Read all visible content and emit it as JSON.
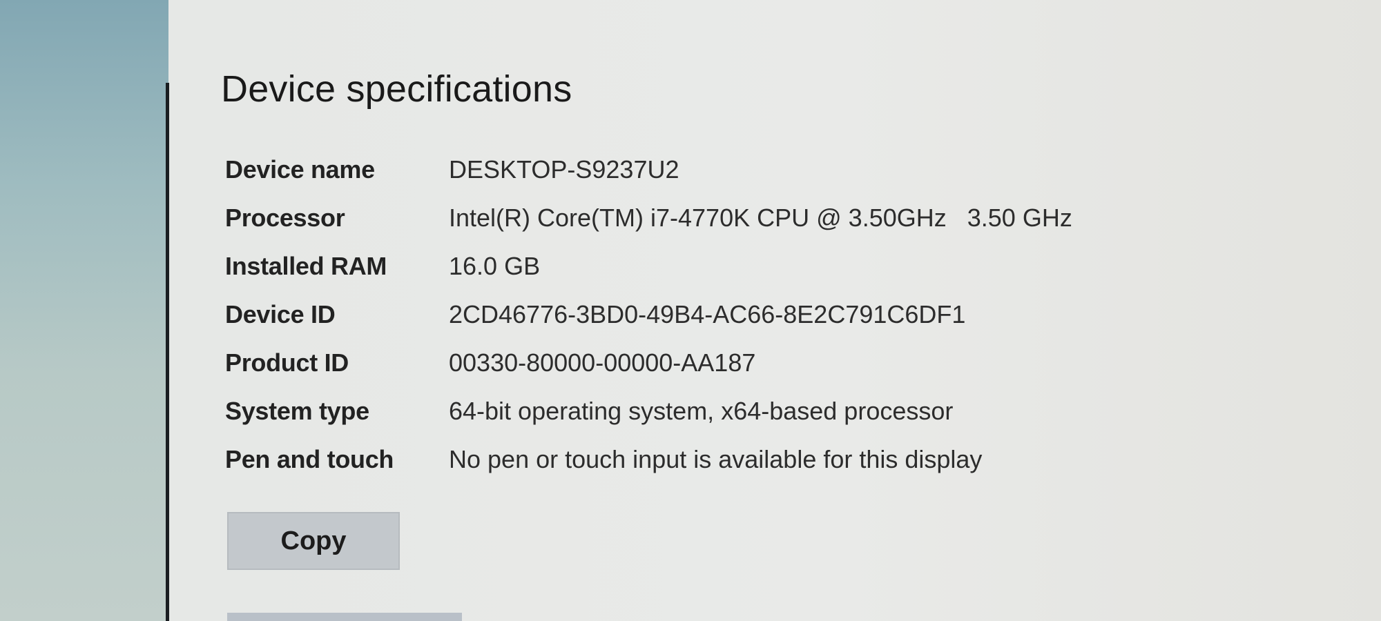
{
  "section": {
    "title": "Device specifications"
  },
  "specs": [
    {
      "label": "Device name",
      "value": "DESKTOP-S9237U2"
    },
    {
      "label": "Processor",
      "value": "Intel(R) Core(TM) i7-4770K CPU @ 3.50GHz   3.50 GHz"
    },
    {
      "label": "Installed RAM",
      "value": "16.0 GB"
    },
    {
      "label": "Device ID",
      "value": "2CD46776-3BD0-49B4-AC66-8E2C791C6DF1"
    },
    {
      "label": "Product ID",
      "value": "00330-80000-00000-AA187"
    },
    {
      "label": "System type",
      "value": "64-bit operating system, x64-based processor"
    },
    {
      "label": "Pen and touch",
      "value": "No pen or touch input is available for this display"
    }
  ],
  "actions": {
    "copy_label": "Copy"
  }
}
